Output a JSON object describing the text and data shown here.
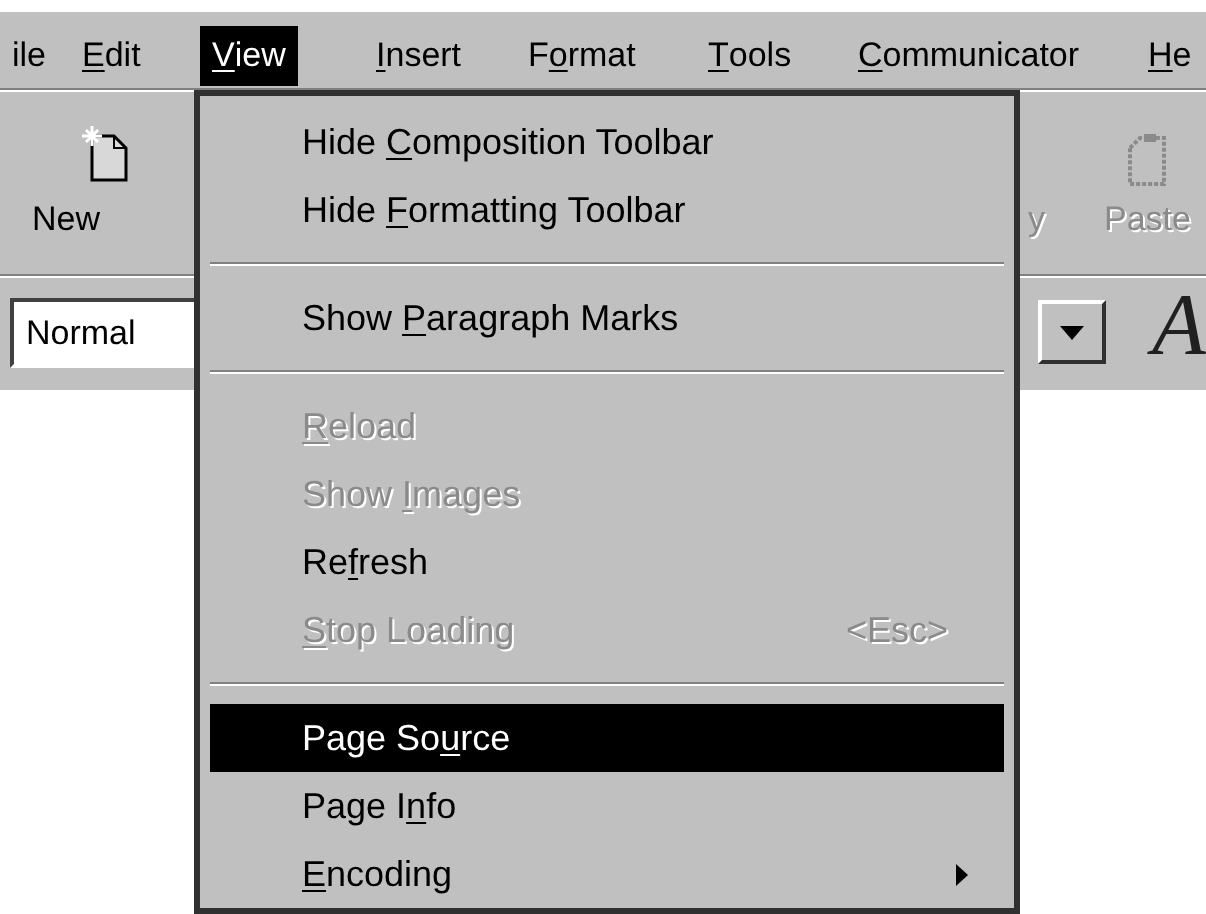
{
  "menu_bar": [
    {
      "label": {
        "after": "ile"
      },
      "selected": false
    },
    {
      "label": {
        "key": "E",
        "after": "dit"
      },
      "selected": false
    },
    {
      "label": {
        "key": "V",
        "after": "iew"
      },
      "selected": true
    },
    {
      "label": {
        "key": "I",
        "after": "nsert"
      },
      "selected": false
    },
    {
      "label": {
        "before": "F",
        "key": "o",
        "after": "rmat"
      },
      "selected": false
    },
    {
      "label": {
        "key": "T",
        "after": "ools"
      },
      "selected": false
    },
    {
      "label": {
        "key": "C",
        "after": "ommunicator"
      },
      "selected": false
    },
    {
      "label": {
        "key": "H",
        "after": "e"
      },
      "selected": false
    }
  ],
  "toolbar": [
    {
      "label": "New",
      "disabled": false
    },
    {
      "label": "y",
      "disabled": true
    },
    {
      "label": "Paste",
      "disabled": true
    }
  ],
  "format_bar": {
    "style_value": "Normal",
    "glyph": "A"
  },
  "view_menu": [
    {
      "kind": "item",
      "label": {
        "before": "Hide ",
        "key": "C",
        "after": "omposition Toolbar"
      },
      "disabled": false,
      "selected": false
    },
    {
      "kind": "item",
      "label": {
        "before": "Hide ",
        "key": "F",
        "after": "ormatting Toolbar"
      },
      "disabled": false,
      "selected": false
    },
    {
      "kind": "separator"
    },
    {
      "kind": "item",
      "label": {
        "before": "Show ",
        "key": "P",
        "after": "aragraph Marks"
      },
      "disabled": false,
      "selected": false
    },
    {
      "kind": "separator"
    },
    {
      "kind": "item",
      "label": {
        "key": "R",
        "after": "eload"
      },
      "disabled": true,
      "selected": false
    },
    {
      "kind": "item",
      "label": {
        "before": "Show ",
        "key": "I",
        "after": "mages"
      },
      "disabled": true,
      "selected": false
    },
    {
      "kind": "item",
      "label": {
        "before": "Re",
        "key": "f",
        "after": "resh"
      },
      "disabled": false,
      "selected": false
    },
    {
      "kind": "item",
      "label": {
        "key": "S",
        "after": "top Loading"
      },
      "disabled": true,
      "selected": false,
      "shortcut": "<Esc>"
    },
    {
      "kind": "separator"
    },
    {
      "kind": "item",
      "label": {
        "before": "Page So",
        "key": "u",
        "after": "rce"
      },
      "disabled": false,
      "selected": true
    },
    {
      "kind": "item",
      "label": {
        "before": "Page I",
        "key": "n",
        "after": "fo"
      },
      "disabled": false,
      "selected": false
    },
    {
      "kind": "item",
      "label": {
        "key": "E",
        "after": "ncoding"
      },
      "disabled": false,
      "selected": false,
      "submenu": true
    }
  ]
}
